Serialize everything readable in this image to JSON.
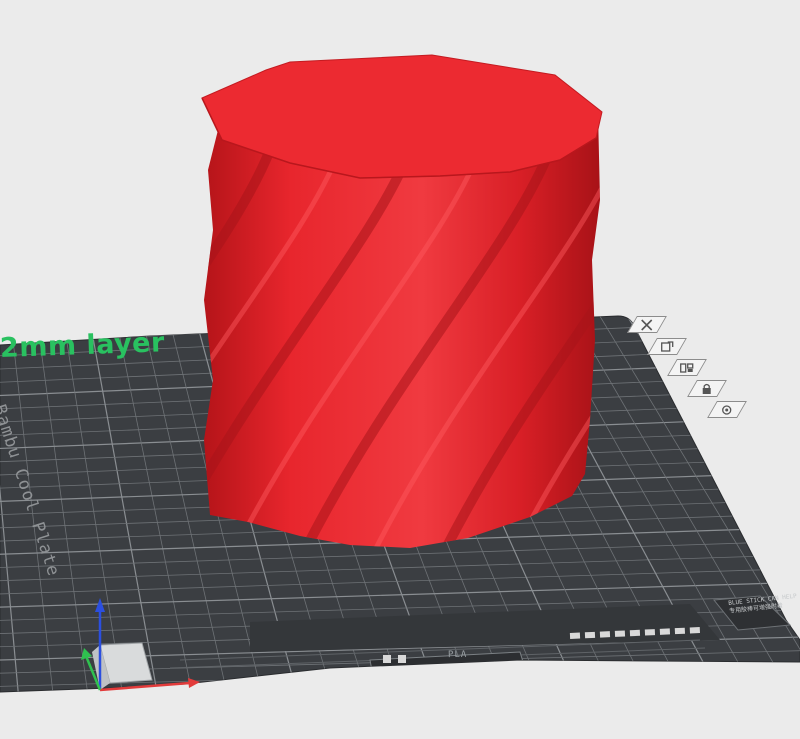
{
  "viewport": {
    "plate_label": "2mm layer",
    "bed_brand": "Bambu Cool Plate",
    "plate_tag": "PLA",
    "corner_note": "BLUE STICK CAN HELP\n专用胶棒可增强附着"
  },
  "plate_toolbar": {
    "items": [
      {
        "name": "delete-plate-button",
        "icon": "close-icon"
      },
      {
        "name": "orient-plate-button",
        "icon": "orient-icon"
      },
      {
        "name": "arrange-plate-button",
        "icon": "arrange-icon"
      },
      {
        "name": "lock-plate-button",
        "icon": "lock-icon"
      },
      {
        "name": "plate-settings-button",
        "icon": "gear-icon"
      }
    ]
  },
  "colors": {
    "background": "#ebebeb",
    "bed": "#3b3e42",
    "grid": "#6e7276",
    "model": "#e8262d",
    "model_top": "#ec2a31",
    "plate_label": "#29c160",
    "axis_x": "#e23b3b",
    "axis_y": "#2fc14f",
    "axis_z": "#2b4fe0"
  }
}
